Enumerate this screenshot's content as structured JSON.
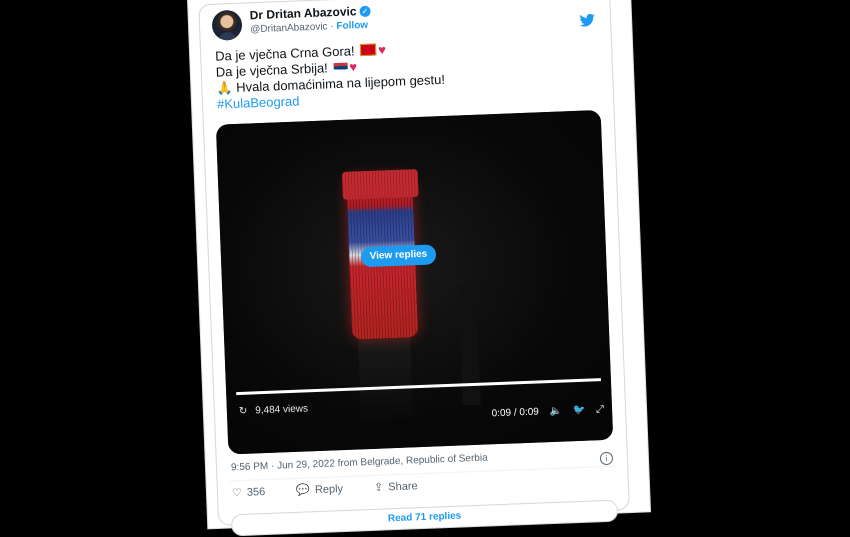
{
  "user": {
    "name": "Dr Dritan Abazovic",
    "verified_icon": "verified-badge-icon",
    "handle": "@DritanAbazovic",
    "separator": " · ",
    "follow_label": "Follow"
  },
  "tweet": {
    "line1": "Da je vječna Crna Gora!",
    "line2": "Da je vječna Srbija!",
    "line3": "Hvala domaćinima na lijepom gestu!",
    "hashtag": "#KulaBeograd",
    "pray_emoji": "🙏",
    "heart_emoji": "♥"
  },
  "media": {
    "view_replies_label": "View replies",
    "views_label": "9,484 views",
    "time_label": "0:09 / 0:09",
    "progress_fraction": 1.0
  },
  "meta": {
    "timestamp": "9:56 PM · Jun 29, 2022 from Belgrade, Republic of Serbia"
  },
  "actions": {
    "like_count": "356",
    "reply_label": "Reply",
    "share_label": "Share"
  },
  "footer": {
    "read_label": "Read 71 replies"
  },
  "colors": {
    "accent": "#1d9bf0",
    "heart": "#e0245e"
  }
}
